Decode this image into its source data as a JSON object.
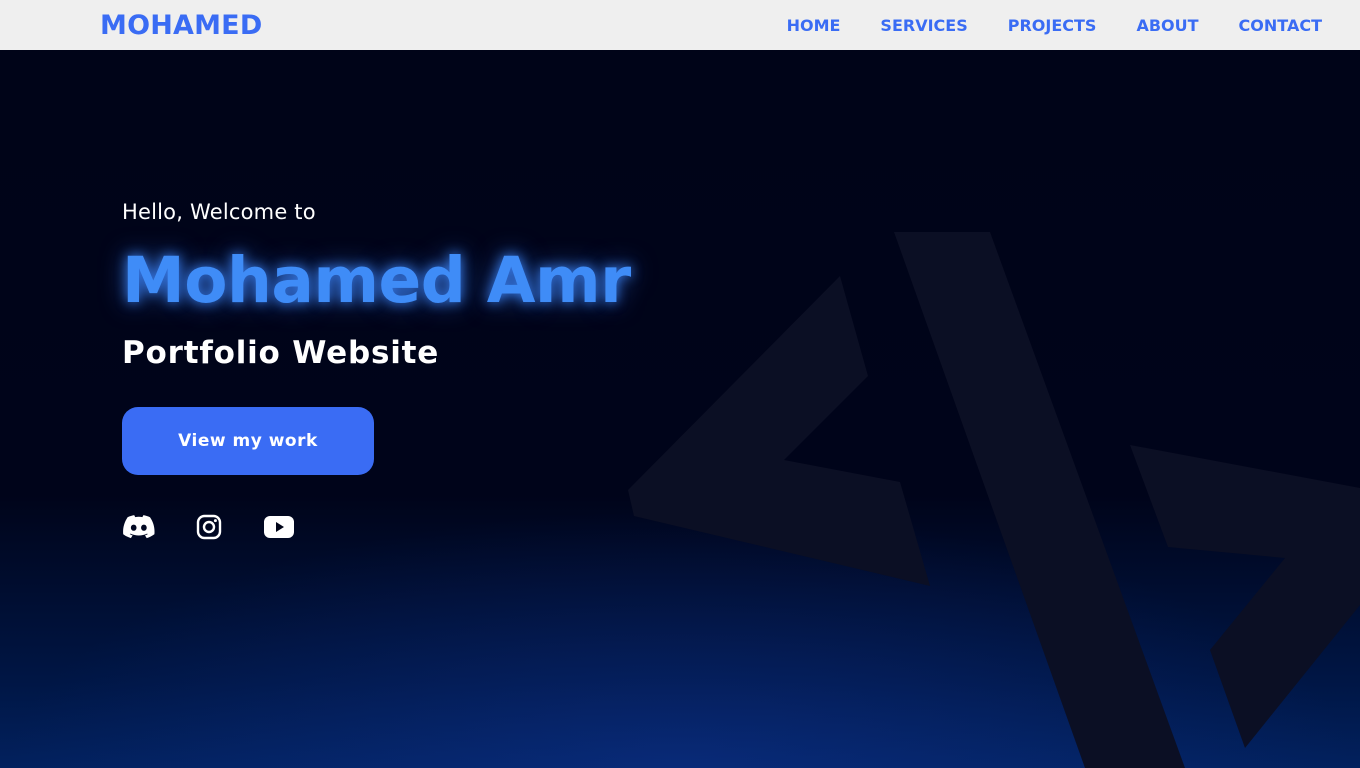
{
  "nav": {
    "logo": "MOHAMED",
    "links": [
      {
        "label": "HOME"
      },
      {
        "label": "SERVICES"
      },
      {
        "label": "PROJECTS"
      },
      {
        "label": "ABOUT"
      },
      {
        "label": "CONTACT"
      }
    ]
  },
  "hero": {
    "greeting": "Hello, Welcome to",
    "name": "Mohamed Amr",
    "subtitle": "Portfolio Website",
    "cta_label": "View my work",
    "socials": [
      "discord-icon",
      "instagram-icon",
      "youtube-icon"
    ]
  },
  "colors": {
    "accent": "#3a6cf4",
    "name_glow": "#3f8cf7",
    "navbar_bg": "#efefef",
    "hero_bg": "#000418"
  }
}
